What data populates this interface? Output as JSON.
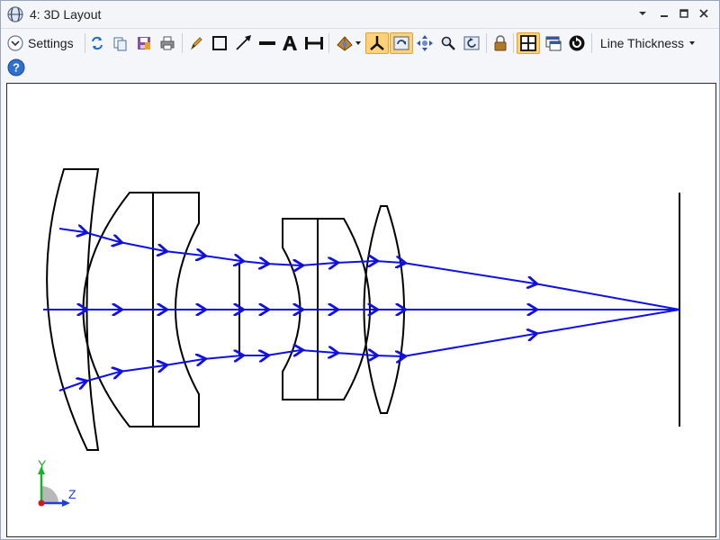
{
  "window": {
    "title": "4: 3D Layout"
  },
  "toolbar": {
    "settings_label": "Settings",
    "line_thickness_label": "Line Thickness",
    "icons": [
      "expand-icon",
      "refresh-icon",
      "copy-icon",
      "save-icon",
      "print-icon",
      "pencil-icon",
      "rectangle-icon",
      "arrow-line-icon",
      "line-icon",
      "text-icon",
      "dimension-icon",
      "rotate-view-icon",
      "axes-icon",
      "rotate-mode-icon",
      "pan-icon",
      "zoom-icon",
      "reset-view-icon",
      "lock-icon",
      "tile-icon",
      "window-icon",
      "reset-icon",
      "help-icon"
    ]
  },
  "axis_triad": {
    "y_label": "Y",
    "z_label": "Z"
  },
  "colors": {
    "rays": "#1010e0",
    "lenses": "#000000",
    "active_tool": "#ffd27a",
    "axis_y": "#19b02a",
    "axis_z": "#1b3fe0",
    "axis_origin": "#d01818"
  }
}
